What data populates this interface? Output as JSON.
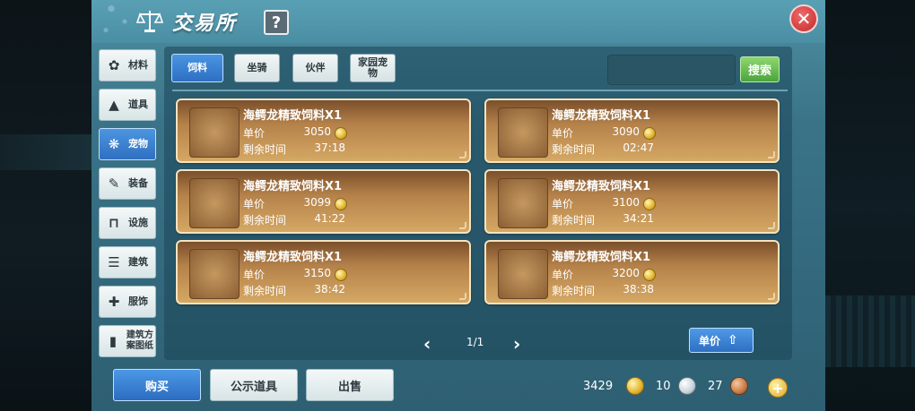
{
  "header": {
    "title": "交易所",
    "help_label": "?",
    "close_label": "✕"
  },
  "sidebar": {
    "items": [
      {
        "label": "材料",
        "icon": "material-icon",
        "glyph": "✿",
        "active": false
      },
      {
        "label": "道具",
        "icon": "item-icon",
        "glyph": "▲",
        "active": false
      },
      {
        "label": "宠物",
        "icon": "paw-icon",
        "glyph": "❋",
        "active": true
      },
      {
        "label": "装备",
        "icon": "equipment-icon",
        "glyph": "✎",
        "active": false
      },
      {
        "label": "设施",
        "icon": "facility-icon",
        "glyph": "⊓",
        "active": false
      },
      {
        "label": "建筑",
        "icon": "building-icon",
        "glyph": "☰",
        "active": false
      },
      {
        "label": "服饰",
        "icon": "clothing-icon",
        "glyph": "✚",
        "active": false
      },
      {
        "label": "建筑方案图纸",
        "icon": "blueprint-icon",
        "glyph": "▮",
        "active": false
      }
    ]
  },
  "tabs": [
    {
      "label": "饲料",
      "active": true
    },
    {
      "label": "坐骑",
      "active": false
    },
    {
      "label": "伙伴",
      "active": false
    },
    {
      "label": "家园宠物",
      "active": false
    }
  ],
  "search": {
    "placeholder": "",
    "button_label": "搜索"
  },
  "listings": {
    "price_label": "单价",
    "time_label": "剩余时间",
    "items": [
      {
        "name": "海鳄龙精致饲料X1",
        "price": "3050",
        "time": "37:18"
      },
      {
        "name": "海鳄龙精致饲料X1",
        "price": "3090",
        "time": "02:47"
      },
      {
        "name": "海鳄龙精致饲料X1",
        "price": "3099",
        "time": "41:22"
      },
      {
        "name": "海鳄龙精致饲料X1",
        "price": "3100",
        "time": "34:21"
      },
      {
        "name": "海鳄龙精致饲料X1",
        "price": "3150",
        "time": "38:42"
      },
      {
        "name": "海鳄龙精致饲料X1",
        "price": "3200",
        "time": "38:38"
      }
    ]
  },
  "pagination": {
    "text": "1/1",
    "prev": "‹",
    "next": "›"
  },
  "sort": {
    "label": "单价",
    "arrow": "⇧"
  },
  "bottom": {
    "buy_label": "购买",
    "public_label": "公示道具",
    "sell_label": "出售"
  },
  "currency": {
    "gold": "3429",
    "silver": "10",
    "bronze": "27",
    "add": "+"
  },
  "colors": {
    "panel": "#3a7388",
    "accent_blue": "#2e6fc2",
    "card": "#b5824a",
    "search_green": "#4aa53a",
    "close_red": "#c22a2a"
  }
}
